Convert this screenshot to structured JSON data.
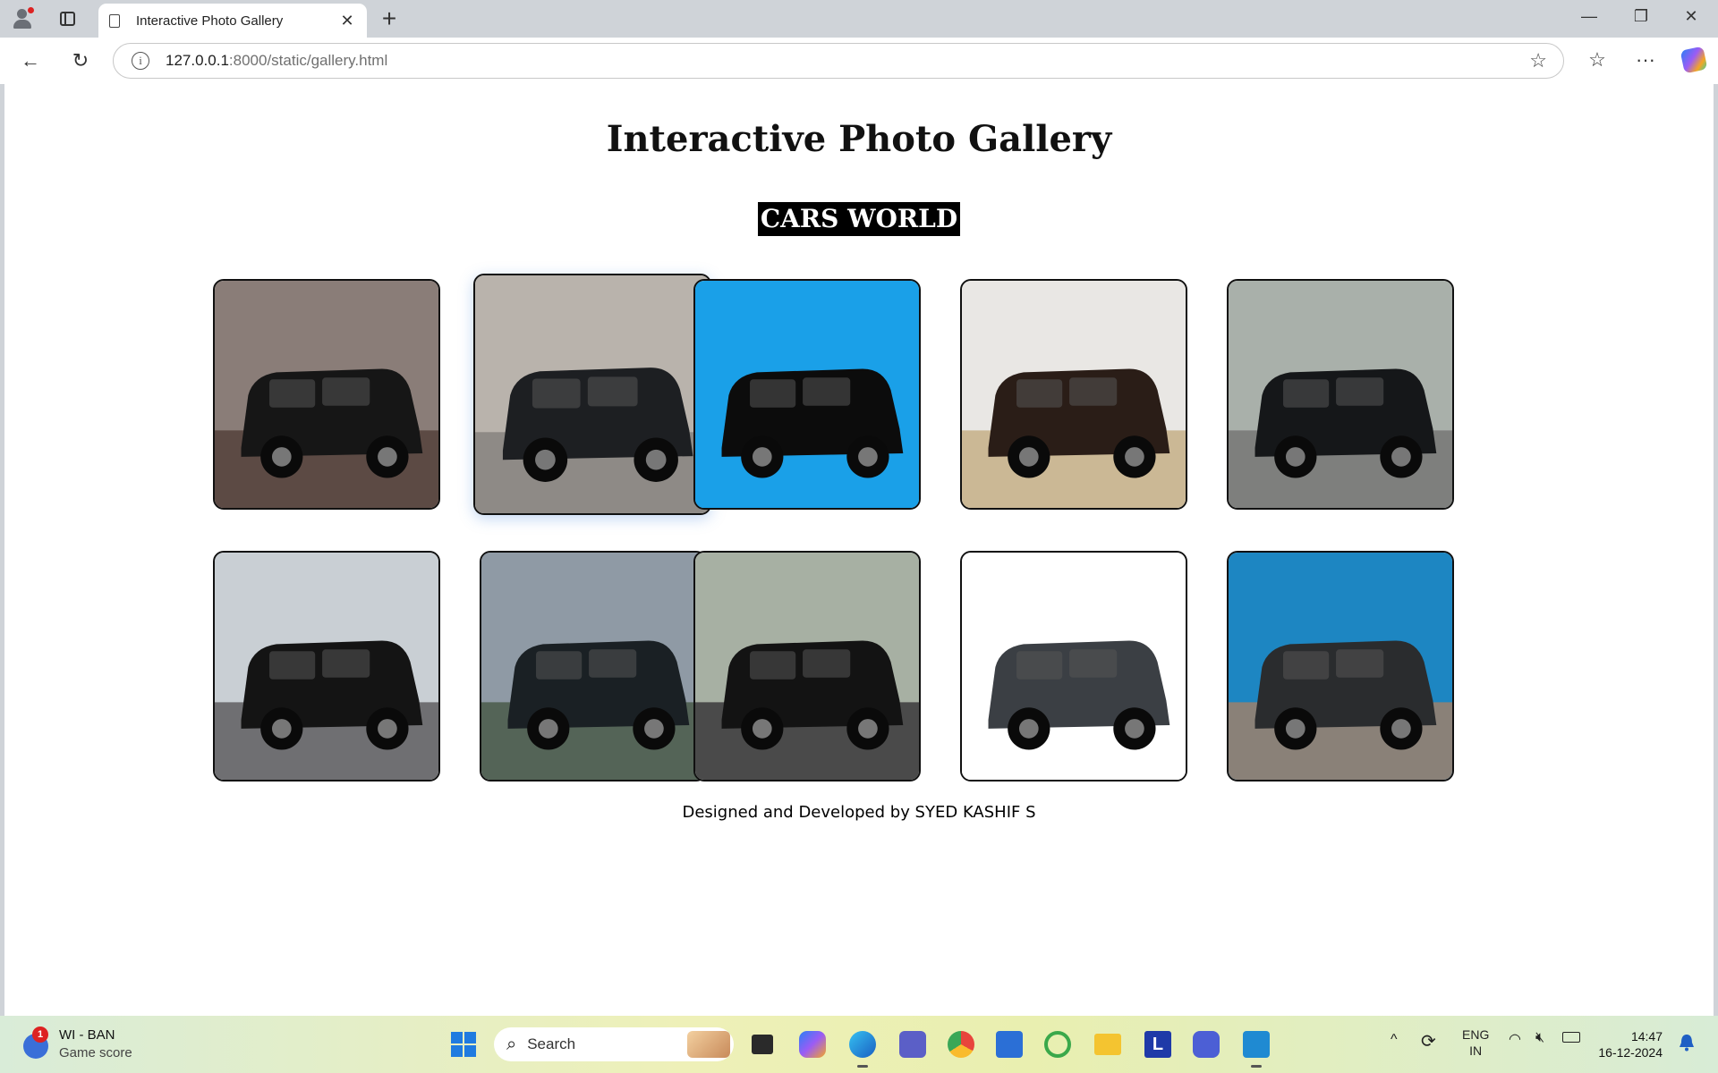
{
  "browser": {
    "tab_title": "Interactive Photo Gallery",
    "tab_close": "✕",
    "new_tab": "+",
    "url_host": "127.0.0.1",
    "url_rest": ":8000/static/gallery.html",
    "window_controls": [
      "—",
      "❐",
      "✕"
    ],
    "back": "←",
    "reload": "↻",
    "favorite": "☆",
    "favorites_bar": "☆",
    "more": "···",
    "info": "i"
  },
  "page": {
    "title": "Interactive Photo Gallery",
    "subtitle": "CARS WORLD",
    "footer": "Designed and Developed by SYED KASHIF S"
  },
  "gallery": [
    {
      "bg": "#8a7d78",
      "car": "#161616",
      "ground": "#5c4a44"
    },
    {
      "bg": "#b9b3ac",
      "car": "#1d1f22",
      "ground": "#8e8a86"
    },
    {
      "bg": "#1aa0e8",
      "car": "#0c0c0c",
      "ground": "#1aa0e8"
    },
    {
      "bg": "#e9e7e4",
      "car": "#2a1d17",
      "ground": "#cbb895"
    },
    {
      "bg": "#a9b0aa",
      "car": "#151719",
      "ground": "#7e7f7d"
    },
    {
      "bg": "#c9cfd4",
      "car": "#141414",
      "ground": "#6f6f72"
    },
    {
      "bg": "#8f9aa5",
      "car": "#1a2024",
      "ground": "#546457"
    },
    {
      "bg": "#a7b0a3",
      "car": "#131313",
      "ground": "#4a4a4a"
    },
    {
      "bg": "#ffffff",
      "car": "#3b3f44",
      "ground": "#ffffff"
    },
    {
      "bg": "#1d86c2",
      "car": "#2a2c2e",
      "ground": "#8a8178"
    }
  ],
  "taskbar": {
    "widget_title": "WI - BAN",
    "widget_subtitle": "Game score",
    "widget_badge": "1",
    "search_label": "Search",
    "lang_top": "ENG",
    "lang_bottom": "IN",
    "time": "14:47",
    "date": "16-12-2024",
    "tray_chevron": "^",
    "colors": {
      "copilot": "#7a5af5",
      "edge": "#1a8fd8",
      "teams": "#5b5fc7",
      "chrome": "#e8453c",
      "store": "#2b6fd6",
      "green": "#3aa84a",
      "folder": "#f4c430",
      "l_app": "#1f3aa8",
      "a_app": "#4c5fd5",
      "vscode": "#1f8ad2"
    }
  }
}
